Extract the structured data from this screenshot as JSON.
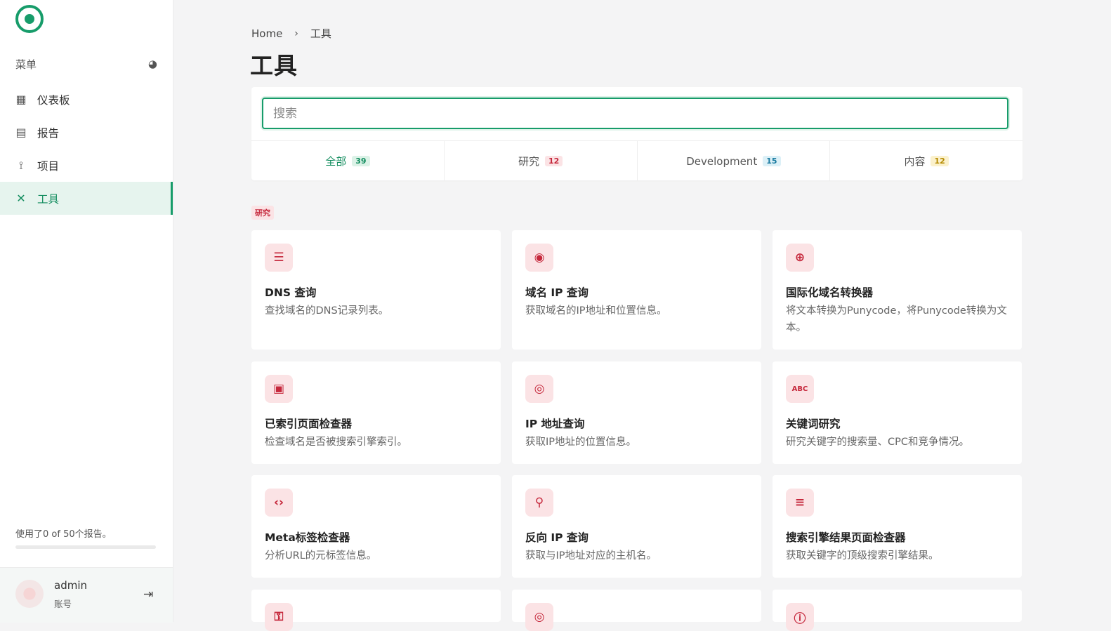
{
  "sidebar": {
    "menu_label": "菜单",
    "items": [
      {
        "label": "仪表板",
        "icon": "dashboard-icon"
      },
      {
        "label": "报告",
        "icon": "report-icon"
      },
      {
        "label": "项目",
        "icon": "projects-icon"
      },
      {
        "label": "工具",
        "icon": "tools-icon",
        "active": true
      }
    ],
    "usage_text": "使用了0 of 50个报告。",
    "usage_fraction": 0,
    "user": {
      "name": "admin",
      "role": "账号"
    }
  },
  "breadcrumb": {
    "home": "Home",
    "current": "工具"
  },
  "page_title": "工具",
  "search": {
    "placeholder": "搜索"
  },
  "tabs": [
    {
      "label": "全部",
      "count": "39"
    },
    {
      "label": "研究",
      "count": "12"
    },
    {
      "label": "Development",
      "count": "15"
    },
    {
      "label": "内容",
      "count": "12"
    }
  ],
  "section_tag": "研究",
  "cards": [
    {
      "title": "DNS 查询",
      "desc": "查找域名的DNS记录列表。",
      "icon": "server-icon"
    },
    {
      "title": "域名 IP 查询",
      "desc": "获取域名的IP地址和位置信息。",
      "icon": "location-icon"
    },
    {
      "title": "国际化域名转换器",
      "desc": "将文本转换为Punycode，将Punycode转换为文本。",
      "icon": "globe-icon"
    },
    {
      "title": "已索引页面检查器",
      "desc": "检查域名是否被搜索引擎索引。",
      "icon": "file-search-icon"
    },
    {
      "title": "IP 地址查询",
      "desc": "获取IP地址的位置信息。",
      "icon": "globe-search-icon"
    },
    {
      "title": "关键词研究",
      "desc": "研究关键字的搜索量、CPC和竞争情况。",
      "icon": "abc-icon"
    },
    {
      "title": "Meta标签检查器",
      "desc": "分析URL的元标签信息。",
      "icon": "code-icon"
    },
    {
      "title": "反向 IP 查询",
      "desc": "获取与IP地址对应的主机名。",
      "icon": "reverse-search-icon"
    },
    {
      "title": "搜索引擎结果页面检查器",
      "desc": "获取关键字的顶级搜索引擎结果。",
      "icon": "list-search-icon"
    }
  ],
  "colors": {
    "accent": "#179c6a",
    "research": "#c5273b"
  }
}
